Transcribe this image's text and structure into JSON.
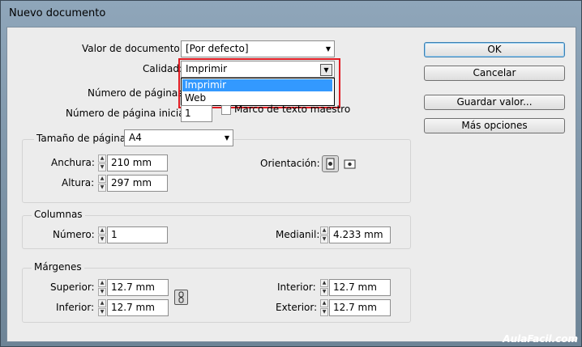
{
  "window": {
    "title": "Nuevo documento"
  },
  "form": {
    "valor_label": "Valor de documento:",
    "valor_value": "[Por defecto]",
    "calidad_label": "Calidad:",
    "calidad_value": "Imprimir",
    "calidad_options": [
      "Imprimir",
      "Web"
    ],
    "num_paginas_label": "Número de páginas:",
    "num_inicial_label": "Número de página inicial:",
    "num_inicial_value": "1",
    "marco_label": "Marco de texto maestro"
  },
  "tamano": {
    "label": "Tamaño de página:",
    "value": "A4",
    "anchura_label": "Anchura:",
    "anchura_value": "210 mm",
    "altura_label": "Altura:",
    "altura_value": "297 mm",
    "orientacion_label": "Orientación:"
  },
  "columnas": {
    "title": "Columnas",
    "numero_label": "Número:",
    "numero_value": "1",
    "medianil_label": "Medianil:",
    "medianil_value": "4.233 mm"
  },
  "margenes": {
    "title": "Márgenes",
    "superior_label": "Superior:",
    "superior_value": "12.7 mm",
    "inferior_label": "Inferior:",
    "inferior_value": "12.7 mm",
    "interior_label": "Interior:",
    "interior_value": "12.7 mm",
    "exterior_label": "Exterior:",
    "exterior_value": "12.7 mm"
  },
  "buttons": {
    "ok": "OK",
    "cancelar": "Cancelar",
    "guardar": "Guardar valor...",
    "mas": "Más opciones"
  },
  "watermark": "AulaFacil.com",
  "colors": {
    "highlight": "#3399ff",
    "annotation": "#e11b22"
  }
}
